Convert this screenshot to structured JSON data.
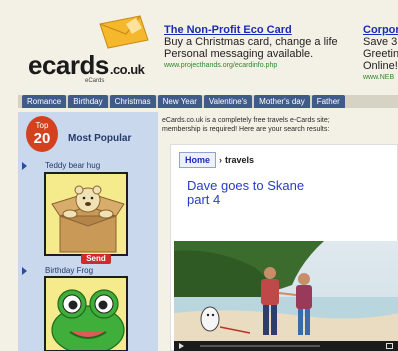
{
  "logo": {
    "brand": "ecards",
    "suffix": ".co.uk",
    "tagline": "eCards"
  },
  "ads": [
    {
      "title": "The Non-Profit Eco Card",
      "line1": "Buy a Christmas card, change a life",
      "line2": "Personal messaging available.",
      "url": "www.projecthands.org/ecardinfo.php"
    },
    {
      "title": "Corpor",
      "line1": "Save 3",
      "line2": "Greetin",
      "line3": "Online!",
      "url": "www.NEB"
    }
  ],
  "nav": {
    "tabs": [
      "Romance",
      "Birthday",
      "Christmas",
      "New Year",
      "Valentine's",
      "Mother's day",
      "Father"
    ]
  },
  "sidebar": {
    "badge_top": "Top",
    "badge_num": "20",
    "heading": "Most Popular",
    "items": [
      {
        "label": "Teddy bear hug"
      },
      {
        "label": "Birthday Frog"
      }
    ],
    "send_label": "Send"
  },
  "main": {
    "intro_line1": "eCards.co.uk is a completely free travels e-Cards site;",
    "intro_line2": "membership is required! Here are your search results:",
    "breadcrumb_home": "Home",
    "breadcrumb_sep": "›",
    "breadcrumb_current": "travels",
    "card_title": "Dave goes to Skane part 4"
  },
  "colors": {
    "nav_tab": "#3f5b8a",
    "link_blue": "#1a2bb8",
    "sidebar_bg": "#c9d8ec",
    "top20_red": "#d4411f"
  }
}
